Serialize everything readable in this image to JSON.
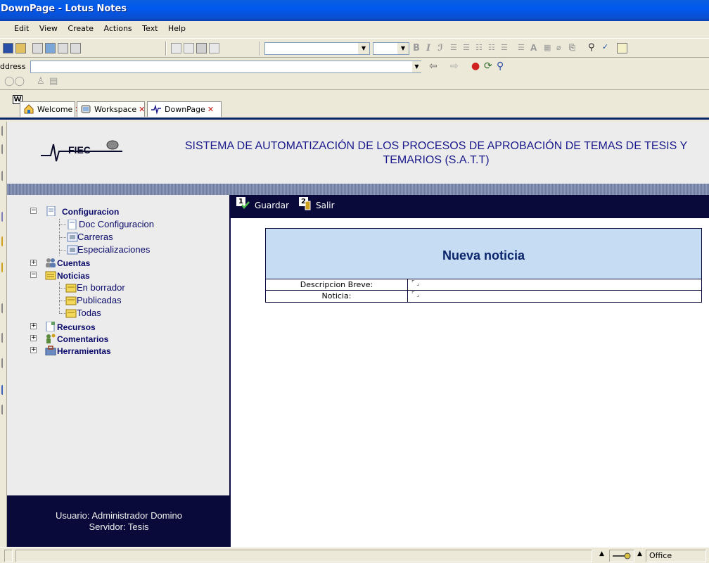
{
  "window": {
    "title": "DownPage - Lotus Notes"
  },
  "menu": [
    "Edit",
    "View",
    "Create",
    "Actions",
    "Text",
    "Help"
  ],
  "address": {
    "label": "ddress",
    "value": ""
  },
  "tabs": [
    {
      "label": "Welcome",
      "icon": "home-icon",
      "closable": true
    },
    {
      "label": "Workspace",
      "icon": "workspace-icon",
      "closable": true
    },
    {
      "label": "DownPage",
      "icon": "database-icon",
      "closable": true,
      "active": true
    }
  ],
  "tab_close_glyph": "✕",
  "w_badge": "W",
  "header": {
    "logo_text": "FIEC",
    "title": "SISTEMA DE AUTOMATIZACIÓN DE LOS PROCESOS DE APROBACIÓN DE TEMAS DE TESIS Y TEMARIOS (S.A.T.T)"
  },
  "sidebar": {
    "nodes": [
      {
        "label": "Configuracion",
        "level": 0,
        "expanded": true,
        "icon": "document-icon"
      },
      {
        "label": "Doc Configuracion",
        "level": 1,
        "icon": "document-icon"
      },
      {
        "label": "Carreras",
        "level": 1,
        "icon": "view-icon"
      },
      {
        "label": "Especializaciones",
        "level": 1,
        "icon": "view-icon"
      },
      {
        "label": "Cuentas",
        "level": 0,
        "expanded": false,
        "icon": "users-icon"
      },
      {
        "label": "Noticias",
        "level": 0,
        "expanded": true,
        "icon": "folder-icon"
      },
      {
        "label": "En borrador",
        "level": 1,
        "icon": "folder-icon"
      },
      {
        "label": "Publicadas",
        "level": 1,
        "icon": "folder-icon"
      },
      {
        "label": "Todas",
        "level": 1,
        "icon": "folder-icon"
      },
      {
        "label": "Recursos",
        "level": 0,
        "expanded": false,
        "icon": "document-icon"
      },
      {
        "label": "Comentarios",
        "level": 0,
        "expanded": false,
        "icon": "comments-icon"
      },
      {
        "label": "Herramientas",
        "level": 0,
        "expanded": false,
        "icon": "tools-icon"
      }
    ],
    "expander_glyph_expanded": "−",
    "expander_glyph_collapsed": "+"
  },
  "user_box": {
    "user_line": "Usuario: Administrador Domino",
    "server_line": "Servidor: Tesis"
  },
  "actions": [
    {
      "number": "1",
      "label": "Guardar"
    },
    {
      "number": "2",
      "label": "Salir"
    }
  ],
  "form": {
    "title": "Nueva noticia",
    "fields": [
      {
        "label": "Descripcion Breve:",
        "value": ""
      },
      {
        "label": "Noticia:",
        "value": ""
      }
    ],
    "field_mark": "⌜ ⌟"
  },
  "status": {
    "location": "Office"
  },
  "colors": {
    "title_bar": "#0058ee",
    "navy": "#0a0a3a",
    "form_header": "#c6dcf3",
    "title_text": "#1a1a8c"
  }
}
